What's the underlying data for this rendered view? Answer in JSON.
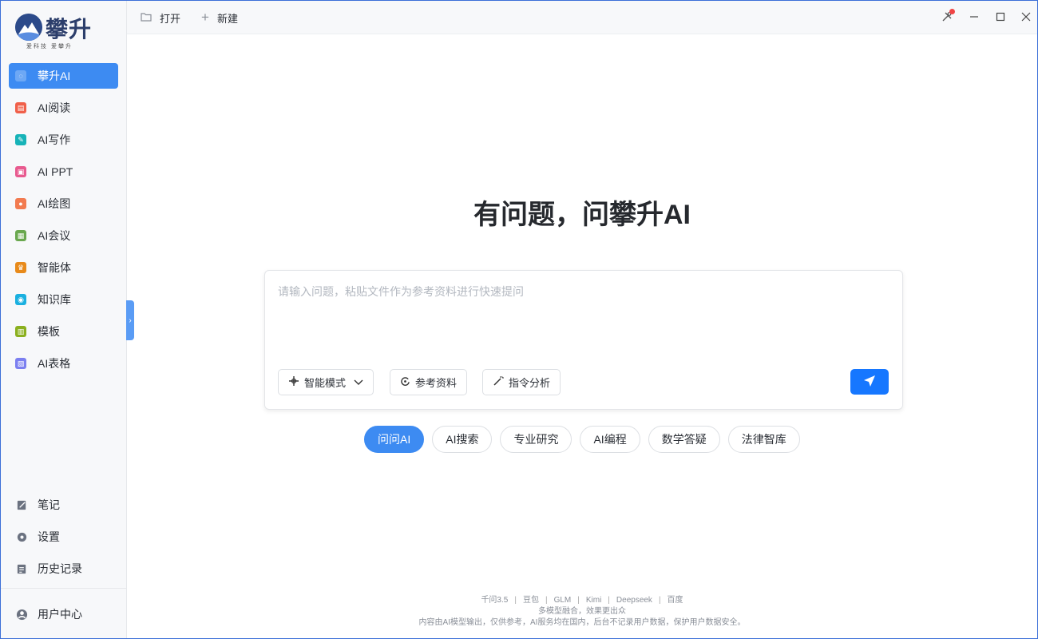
{
  "logo": {
    "text": "攀升",
    "subtitle": "爱科技  爱攀升"
  },
  "sidebar": {
    "items": [
      {
        "label": "攀升AI",
        "icon": "chat-icon",
        "color": "#ffffff",
        "active": true
      },
      {
        "label": "AI阅读",
        "icon": "reader-icon",
        "color": "#f0604a",
        "active": false
      },
      {
        "label": "AI写作",
        "icon": "pen-icon",
        "color": "#17b3b8",
        "active": false
      },
      {
        "label": "AI PPT",
        "icon": "ppt-icon",
        "color": "#e85a8f",
        "active": false
      },
      {
        "label": "AI绘图",
        "icon": "palette-icon",
        "color": "#f27b50",
        "active": false
      },
      {
        "label": "AI会议",
        "icon": "meeting-icon",
        "color": "#6aa84f",
        "active": false
      },
      {
        "label": "智能体",
        "icon": "crown-icon",
        "color": "#e88a1a",
        "active": false
      },
      {
        "label": "知识库",
        "icon": "knowledge-icon",
        "color": "#1ab0e0",
        "active": false
      },
      {
        "label": "模板",
        "icon": "template-icon",
        "color": "#8bb01f",
        "active": false
      },
      {
        "label": "AI表格",
        "icon": "sheet-icon",
        "color": "#7b7ff0",
        "active": false
      }
    ],
    "bottom_items": [
      {
        "label": "笔记",
        "icon": "note-icon"
      },
      {
        "label": "设置",
        "icon": "gear-icon"
      },
      {
        "label": "历史记录",
        "icon": "history-icon"
      }
    ],
    "user_center": "用户中心"
  },
  "titlebar": {
    "open": "打开",
    "new": "新建"
  },
  "main": {
    "headline": "有问题，问攀升AI",
    "input_placeholder": "请输入问题，粘贴文件作为参考资料进行快速提问",
    "tools": {
      "mode": "智能模式",
      "reference": "参考资料",
      "analysis": "指令分析"
    },
    "chips": [
      "问问AI",
      "AI搜索",
      "专业研究",
      "AI编程",
      "数学答疑",
      "法律智库"
    ]
  },
  "footer": {
    "models": [
      "千问3.5",
      "豆包",
      "GLM",
      "Kimi",
      "Deepseek",
      "百度"
    ],
    "line2": "多模型融合，效果更出众",
    "line3": "内容由AI模型输出，仅供参考，AI服务均在国内，后台不记录用户数据，保护用户数据安全。"
  },
  "colors": {
    "accent": "#3d8bf2",
    "send": "#1677ff"
  }
}
